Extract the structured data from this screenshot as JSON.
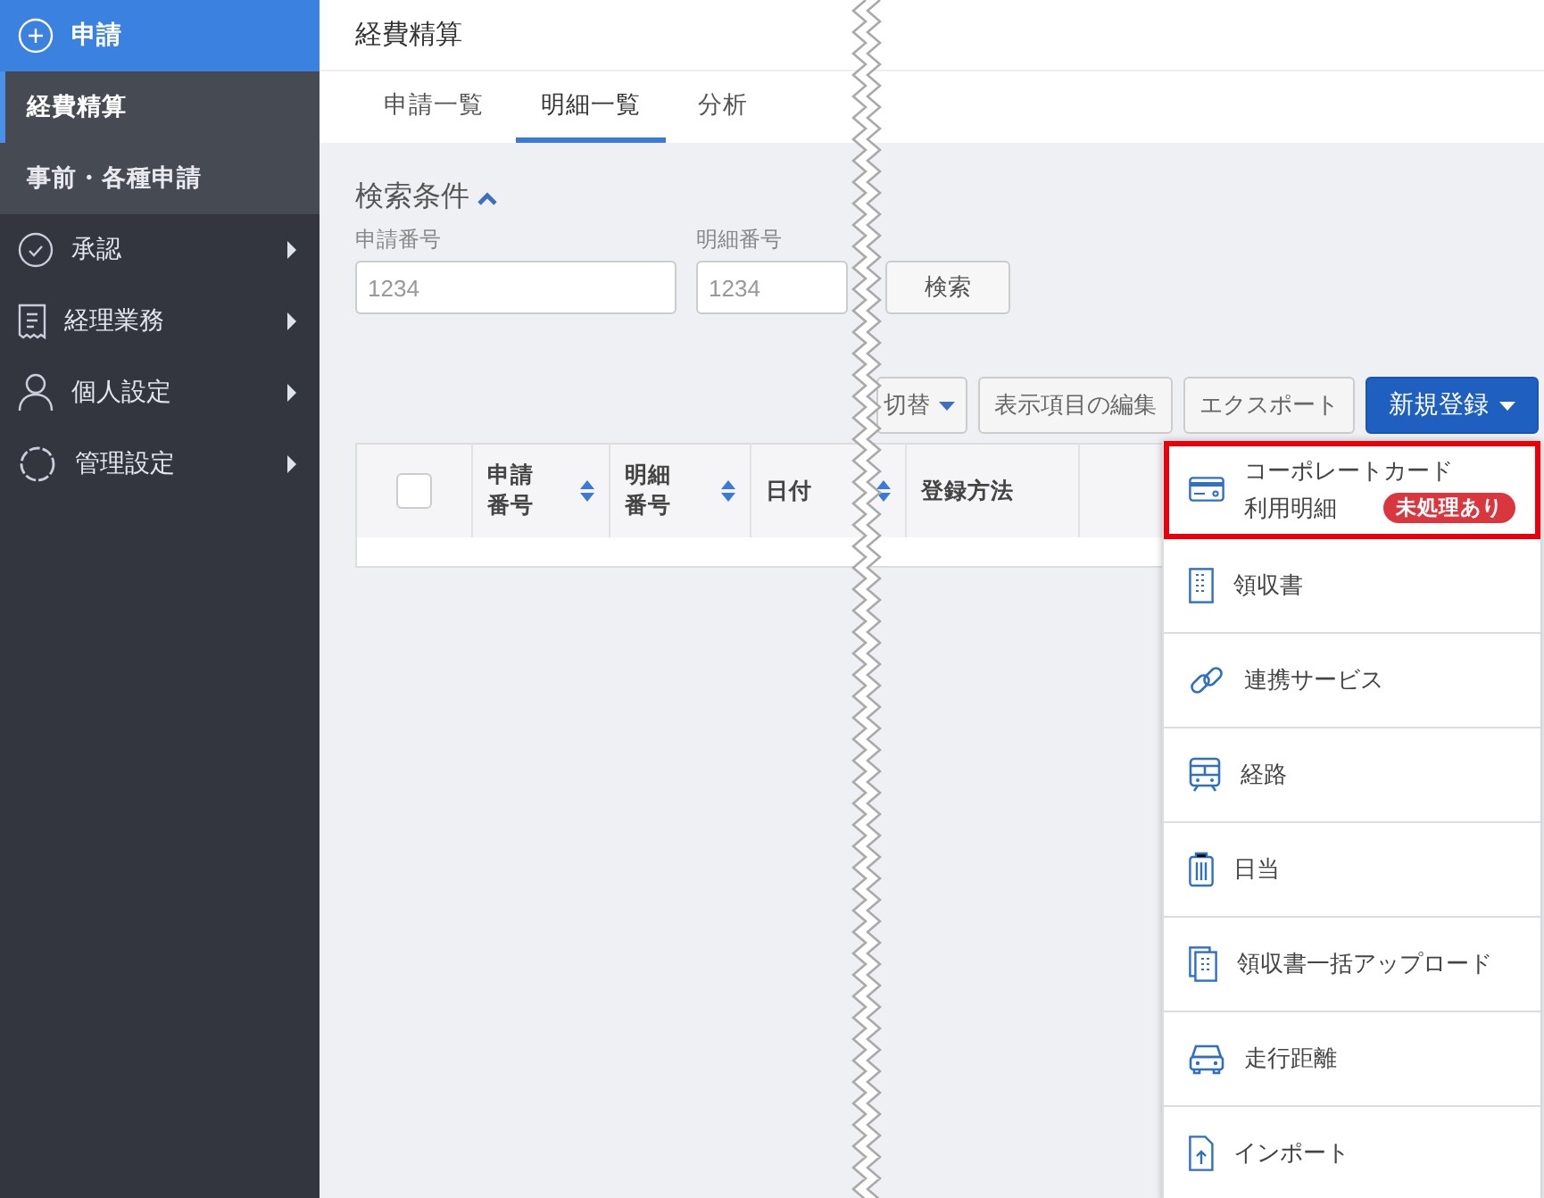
{
  "sidebar": {
    "items": [
      {
        "label": "申請",
        "kind": "plus",
        "expanded": true,
        "children": [
          {
            "label": "経費精算",
            "selected": true
          },
          {
            "label": "事前・各種申請",
            "selected": false
          }
        ]
      },
      {
        "label": "承認",
        "kind": "check",
        "expanded": false
      },
      {
        "label": "経理業務",
        "kind": "receipt",
        "expanded": false
      },
      {
        "label": "個人設定",
        "kind": "person",
        "expanded": false
      },
      {
        "label": "管理設定",
        "kind": "gear",
        "expanded": false
      }
    ]
  },
  "header": {
    "title": "経費精算"
  },
  "tabs": [
    {
      "label": "申請一覧",
      "selected": false
    },
    {
      "label": "明細一覧",
      "selected": true
    },
    {
      "label": "分析",
      "selected": false
    }
  ],
  "search": {
    "title": "検索条件",
    "expanded": true,
    "fields": [
      {
        "label": "申請番号",
        "placeholder": "1234"
      },
      {
        "label": "明細番号",
        "placeholder": "1234"
      }
    ],
    "button": "検索"
  },
  "toolbar": [
    {
      "label": "切替",
      "kind": "dropdown"
    },
    {
      "label": "表示項目の編集",
      "kind": "plain"
    },
    {
      "label": "エクスポート",
      "kind": "plain"
    },
    {
      "label": "新規登録",
      "kind": "primary"
    }
  ],
  "table": {
    "select_all": {
      "checked": false
    },
    "columns": [
      {
        "label": "申請番号",
        "sortable": true
      },
      {
        "label": "明細番号",
        "sortable": true
      },
      {
        "label": "日付",
        "sortable": true
      },
      {
        "label": "登録方法",
        "sortable": false
      }
    ]
  },
  "menu": {
    "items": [
      {
        "kind": "card",
        "title": "コーポレートカード",
        "subtitle": "利用明細",
        "badge": "未処理あり",
        "highlighted": true
      },
      {
        "kind": "receipt",
        "title": "領収書",
        "highlighted": false
      },
      {
        "kind": "link",
        "title": "連携サービス",
        "highlighted": false
      },
      {
        "kind": "train",
        "title": "経路",
        "highlighted": false
      },
      {
        "kind": "suitcase",
        "title": "日当",
        "highlighted": false
      },
      {
        "kind": "receipts",
        "title": "領収書一括アップロード",
        "highlighted": false
      },
      {
        "kind": "car",
        "title": "走行距離",
        "highlighted": false
      },
      {
        "kind": "import",
        "title": "インポート",
        "highlighted": false
      }
    ]
  }
}
